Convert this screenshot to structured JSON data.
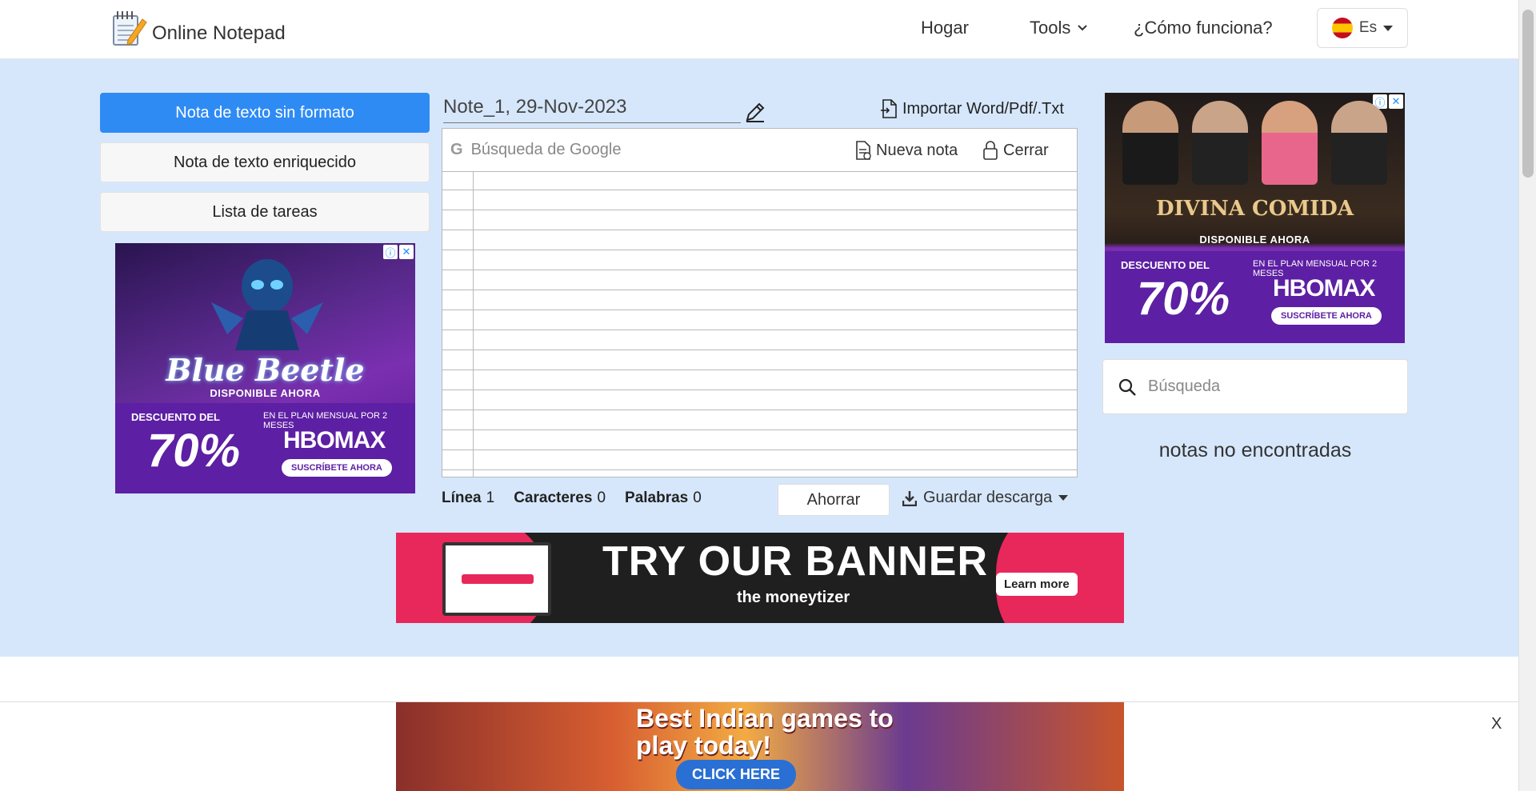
{
  "header": {
    "brand": "Online Notepad",
    "nav": {
      "home": "Hogar",
      "tools": "Tools",
      "how": "¿Cómo funciona?"
    },
    "language": "Es"
  },
  "sidebar": {
    "items": [
      {
        "label": "Nota de texto sin formato",
        "active": true
      },
      {
        "label": "Nota de texto enriquecido",
        "active": false
      },
      {
        "label": "Lista de tareas",
        "active": false
      }
    ]
  },
  "ads": {
    "left": {
      "title": "Blue Beetle",
      "subtitle": "DISPONIBLE AHORA",
      "discount_label": "DESCUENTO DEL",
      "discount": "70%",
      "plan": "EN EL PLAN MENSUAL POR 2 MESES",
      "brand": "HBOMAX",
      "cta": "SUSCRÍBETE AHORA"
    },
    "right": {
      "title": "DIVINA COMIDA",
      "subtitle": "DISPONIBLE AHORA",
      "discount_label": "DESCUENTO DEL",
      "discount": "70%",
      "plan": "EN EL PLAN MENSUAL POR 2 MESES",
      "brand": "HBOMAX",
      "cta": "SUSCRÍBETE AHORA"
    },
    "banner": {
      "headline": "TRY OUR BANNER",
      "brand": "the moneytizer",
      "cta": "Learn more"
    },
    "bottom": {
      "headline": "Best Indian games to play today!",
      "cta": "CLICK HERE"
    }
  },
  "editor": {
    "note_title": "Note_1, 29-Nov-2023",
    "import_label": "Importar Word/Pdf/.Txt",
    "google_search_placeholder": "Búsqueda de Google",
    "new_note": "Nueva nota",
    "close": "Cerrar",
    "content": ""
  },
  "stats": {
    "line_label": "Línea",
    "line_value": "1",
    "chars_label": "Caracteres",
    "chars_value": "0",
    "words_label": "Palabras",
    "words_value": "0"
  },
  "actions": {
    "save": "Ahorrar",
    "download": "Guardar descarga"
  },
  "notes_panel": {
    "search_placeholder": "Búsqueda",
    "empty": "notas no encontradas"
  },
  "bottom_close": "X",
  "colors": {
    "accent": "#2f8bf4",
    "background": "#d6e7fc"
  }
}
